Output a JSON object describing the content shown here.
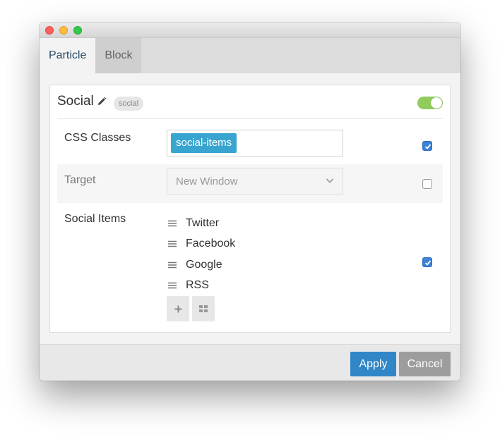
{
  "tabs": [
    {
      "label": "Particle",
      "active": true
    },
    {
      "label": "Block",
      "active": false
    }
  ],
  "card": {
    "title": "Social",
    "badge": "social",
    "enabled": true
  },
  "fields": {
    "css_classes": {
      "label": "CSS Classes",
      "tag": "social-items",
      "checked": true
    },
    "target": {
      "label": "Target",
      "value": "New Window",
      "checked": false
    },
    "social_items": {
      "label": "Social Items",
      "items": [
        "Twitter",
        "Facebook",
        "Google",
        "RSS"
      ],
      "checked": true
    }
  },
  "footer": {
    "apply_label": "Apply",
    "cancel_label": "Cancel"
  },
  "colors": {
    "accent": "#3086c6",
    "tag": "#37a5cf",
    "toggle_on": "#8fcc5b",
    "cancel": "#9d9d9d"
  },
  "icons": [
    "pencil-icon",
    "chevron-down-icon",
    "drag-handle-icon",
    "plus-icon",
    "grid-icon",
    "checkmark-icon"
  ]
}
